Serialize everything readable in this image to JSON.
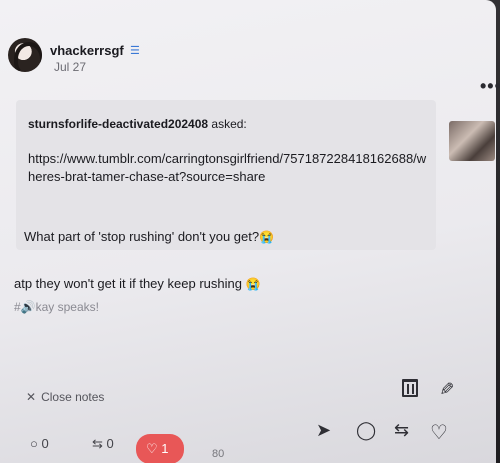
{
  "post": {
    "username": "vhackerrsgf",
    "date": "Jul 27",
    "more_icon": "ellipsis-icon",
    "verified_icon": "badge-icon"
  },
  "ask": {
    "asker": "sturnsforlife-deactivated202408",
    "asked_label": " asked:",
    "link": "https://www.tumblr.com/carringtonsgirlfriend/757187228418162688/wheres-brat-tamer-chase-at?source=share",
    "question": "What part of 'stop rushing' don't you get?",
    "question_emoji": "😭"
  },
  "reply": {
    "text": "atp they won't get it if they keep rushing",
    "emoji": "😭",
    "tag": "#🔊kay speaks!"
  },
  "notes_bar": {
    "close_label": "Close notes",
    "reply_count": "0",
    "reblog_count": "0",
    "like_count": "1",
    "extra": "80"
  },
  "colors": {
    "accent_like": "#e85757",
    "background": "#f2f1f4"
  }
}
